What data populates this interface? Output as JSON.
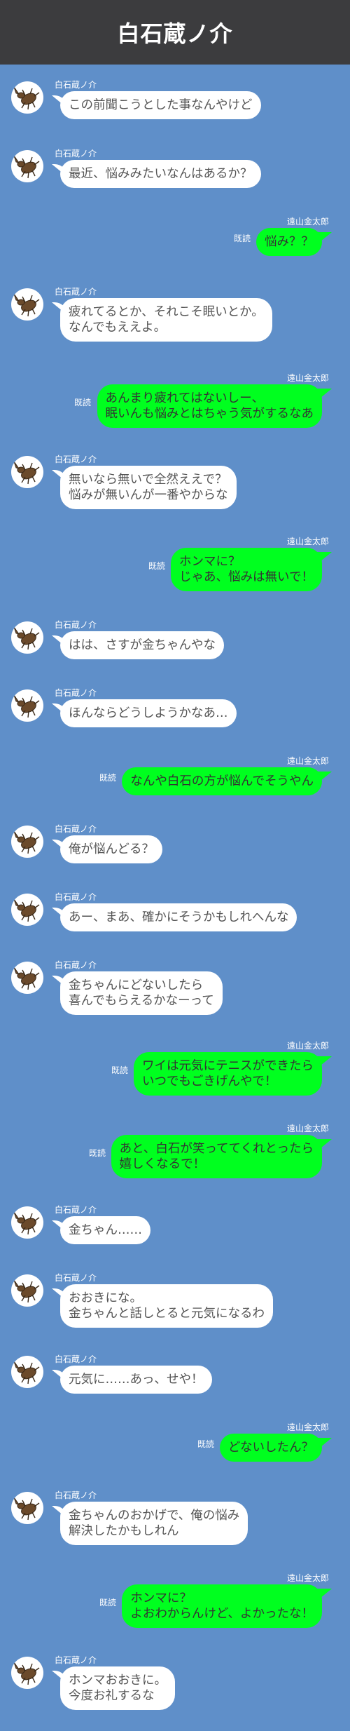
{
  "header": {
    "title": "白石蔵ノ介"
  },
  "names": {
    "left": "白石蔵ノ介",
    "right": "遠山金太郎"
  },
  "read_label": "既読",
  "messages": [
    {
      "side": "in",
      "lines": [
        "この前聞こうとした事なんやけど"
      ]
    },
    {
      "side": "in",
      "lines": [
        "最近、悩みみたいなんはあるか？"
      ]
    },
    {
      "side": "out",
      "lines": [
        "悩み？？"
      ]
    },
    {
      "side": "in",
      "lines": [
        "疲れてるとか、それこそ眠いとか。",
        "なんでもええよ。"
      ]
    },
    {
      "side": "out",
      "lines": [
        "あんまり疲れてはないしー、",
        "眠いんも悩みとはちゃう気がするなあ"
      ]
    },
    {
      "side": "in",
      "lines": [
        "無いなら無いで全然ええで？",
        "悩みが無いんが一番やからな"
      ]
    },
    {
      "side": "out",
      "lines": [
        "ホンマに？",
        "じゃあ、悩みは無いで！"
      ]
    },
    {
      "side": "in",
      "lines": [
        "はは、さすが金ちゃんやな"
      ]
    },
    {
      "side": "in",
      "lines": [
        "ほんならどうしようかなあ…"
      ]
    },
    {
      "side": "out",
      "lines": [
        "なんや白石の方が悩んでそうやん"
      ]
    },
    {
      "side": "in",
      "lines": [
        "俺が悩んどる？"
      ]
    },
    {
      "side": "in",
      "lines": [
        "あー、まあ、確かにそうかもしれへんな"
      ]
    },
    {
      "side": "in",
      "lines": [
        "金ちゃんにどないしたら",
        "喜んでもらえるかなーって"
      ]
    },
    {
      "side": "out",
      "lines": [
        "ワイは元気にテニスができたら",
        "いつでもごきげんやで！"
      ]
    },
    {
      "side": "out",
      "lines": [
        "あと、白石が笑っててくれとったら",
        "嬉しくなるで！"
      ]
    },
    {
      "side": "in",
      "lines": [
        "金ちゃん……"
      ]
    },
    {
      "side": "in",
      "lines": [
        "おおきにな。",
        "金ちゃんと話しとると元気になるわ"
      ]
    },
    {
      "side": "in",
      "lines": [
        "元気に……あっ、せや！"
      ]
    },
    {
      "side": "out",
      "lines": [
        "どないしたん？"
      ]
    },
    {
      "side": "in",
      "lines": [
        "金ちゃんのおかげで、俺の悩み",
        "解決したかもしれん"
      ]
    },
    {
      "side": "out",
      "lines": [
        "ホンマに？",
        "よおわからんけど、よかったな！"
      ]
    },
    {
      "side": "in",
      "lines": [
        "ホンマおおきに。",
        "今度お礼するな"
      ]
    }
  ]
}
